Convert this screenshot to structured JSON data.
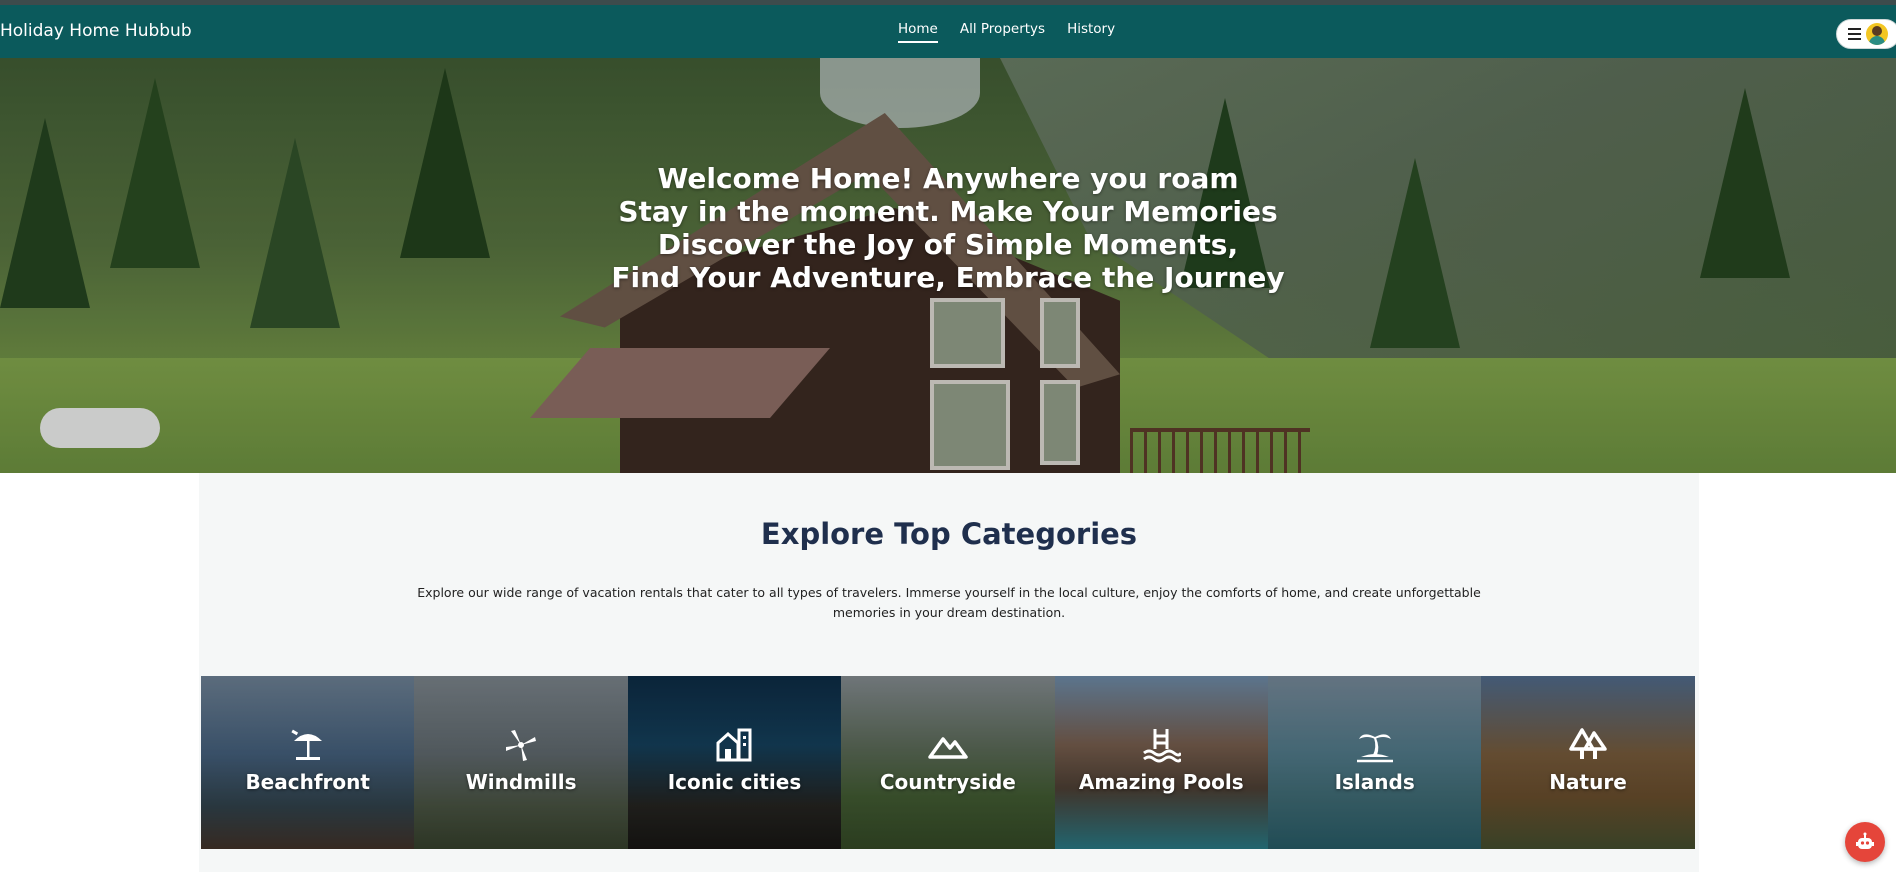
{
  "brand": "Holiday Home Hubbub",
  "nav": {
    "items": [
      {
        "label": "Home",
        "active": true
      },
      {
        "label": "All Propertys",
        "active": false
      },
      {
        "label": "History",
        "active": false
      }
    ]
  },
  "hero": {
    "lines": [
      "Welcome Home! Anywhere you roam",
      "Stay in the moment. Make Your Memories",
      "Discover the Joy of Simple Moments,",
      "Find Your Adventure, Embrace the Journey"
    ]
  },
  "categories": {
    "title": "Explore Top Categories",
    "description": "Explore our wide range of vacation rentals that cater to all types of travelers. Immerse yourself in the local culture, enjoy the comforts of home, and create unforgettable memories in your dream destination.",
    "items": [
      {
        "label": "Beachfront",
        "icon": "beach-umbrella-icon"
      },
      {
        "label": "Windmills",
        "icon": "windmill-icon"
      },
      {
        "label": "Iconic cities",
        "icon": "city-icon"
      },
      {
        "label": "Countryside",
        "icon": "mountain-icon"
      },
      {
        "label": "Amazing Pools",
        "icon": "pool-ladder-icon"
      },
      {
        "label": "Islands",
        "icon": "palm-island-icon"
      },
      {
        "label": "Nature",
        "icon": "pine-trees-icon"
      }
    ]
  },
  "colors": {
    "navbar": "#0b5a5c",
    "title": "#1f2f4d",
    "chat": "#e5453a"
  }
}
